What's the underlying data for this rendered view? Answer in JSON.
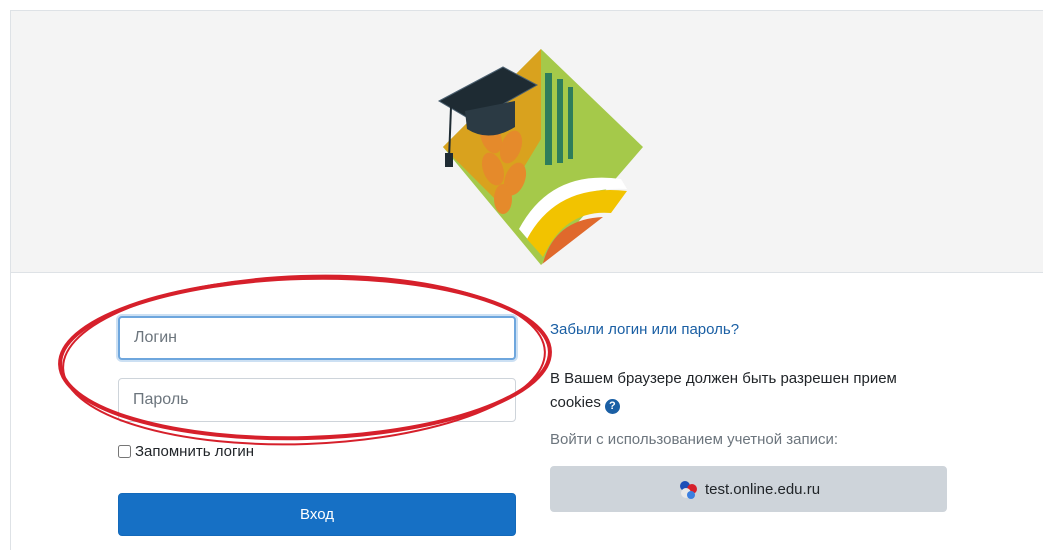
{
  "login_form": {
    "username_placeholder": "Логин",
    "password_placeholder": "Пароль",
    "remember_label": "Запомнить логин",
    "submit_label": "Вход"
  },
  "side_panel": {
    "forgot_link": "Забыли логин или пароль?",
    "cookies_text": "В Вашем браузере должен быть разрешен прием cookies",
    "help_icon": "question-circle-icon",
    "sso_label": "Войти с использованием учетной записи:",
    "sso_button": "test.online.edu.ru",
    "sso_icon": "multi-color-blocks-icon"
  },
  "colors": {
    "primary_button": "#1670c5",
    "link": "#1a5fa4",
    "annotation_oval": "#d6202b",
    "header_background": "#f4f4f4"
  }
}
